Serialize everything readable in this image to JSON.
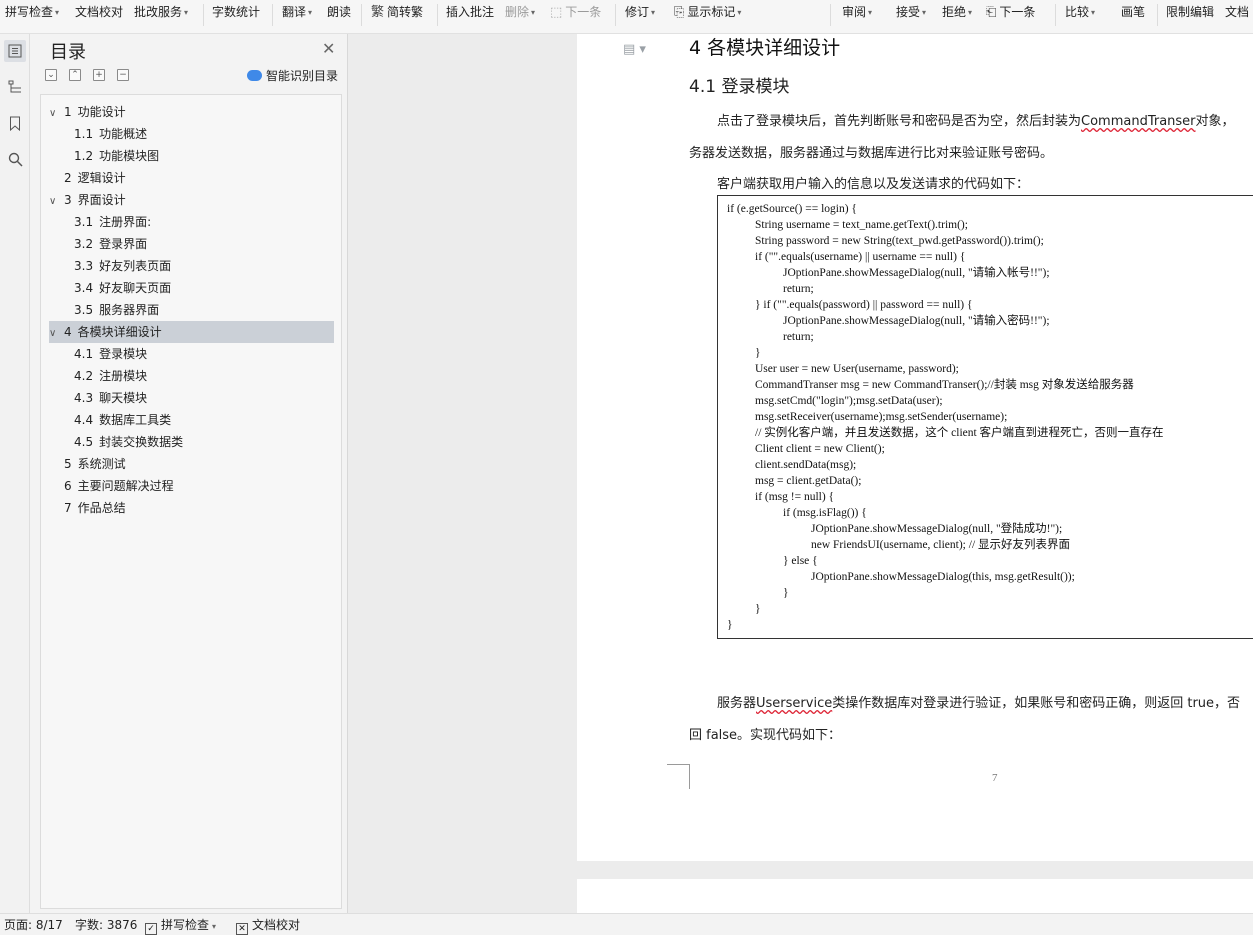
{
  "toolbar": {
    "spell_check": "拼写检查",
    "doc_proof": "文档校对",
    "revise_service": "批改服务",
    "word_count": "字数统计",
    "translate": "翻译",
    "read_aloud": "朗读",
    "simp_trad": "简转繁",
    "insert_comment": "插入批注",
    "delete": "删除",
    "next_comment": "下一条",
    "revise": "修订",
    "show_marks": "显示标记",
    "review": "审阅",
    "accept": "接受",
    "reject": "拒绝",
    "next_change": "下一条",
    "compare": "比较",
    "ink": "画笔",
    "restrict_edit": "限制编辑",
    "doc_rights": "文档"
  },
  "toc": {
    "title": "目录",
    "smart_button": "智能识别目录",
    "items": [
      {
        "num": "1",
        "text": "功能设计",
        "level": 1,
        "expanded": true
      },
      {
        "num": "1.1",
        "text": "功能概述",
        "level": 2
      },
      {
        "num": "1.2",
        "text": "功能模块图",
        "level": 2
      },
      {
        "num": "2",
        "text": "逻辑设计",
        "level": 1
      },
      {
        "num": "3",
        "text": "界面设计",
        "level": 1,
        "expanded": true
      },
      {
        "num": "3.1",
        "text": "注册界面:",
        "level": 2
      },
      {
        "num": "3.2",
        "text": "登录界面",
        "level": 2
      },
      {
        "num": "3.3",
        "text": "好友列表页面",
        "level": 2
      },
      {
        "num": "3.4",
        "text": "好友聊天页面",
        "level": 2
      },
      {
        "num": "3.5",
        "text": "服务器界面",
        "level": 2
      },
      {
        "num": "4",
        "text": "各模块详细设计",
        "level": 1,
        "expanded": true,
        "selected": true
      },
      {
        "num": "4.1",
        "text": "登录模块",
        "level": 2
      },
      {
        "num": "4.2",
        "text": "注册模块",
        "level": 2
      },
      {
        "num": "4.3",
        "text": "聊天模块",
        "level": 2
      },
      {
        "num": "4.4",
        "text": "数据库工具类",
        "level": 2
      },
      {
        "num": "4.5",
        "text": "封装交换数据类",
        "level": 2
      },
      {
        "num": "5",
        "text": "系统测试",
        "level": 1
      },
      {
        "num": "6",
        "text": "主要问题解决过程",
        "level": 1
      },
      {
        "num": "7",
        "text": "作品总结",
        "level": 1
      }
    ]
  },
  "document": {
    "heading1": "4  各模块详细设计",
    "heading2": "4.1 登录模块",
    "para1_a": "点击了登录模块后，首先判断账号和密码是否为空，然后封装为",
    "para1_b": "CommandTranser",
    "para1_c": "对象，",
    "para1_line2": "务器发送数据，服务器通过与数据库进行比对来验证账号密码。",
    "para2": "客户端获取用户输入的信息以及发送请求的代码如下：",
    "code_lines": [
      {
        "indent": 0,
        "text": "if (e.getSource() == login) {"
      },
      {
        "indent": 1,
        "text": "String username = text_name.getText().trim();"
      },
      {
        "indent": 1,
        "text": "String password = new String(text_pwd.getPassword()).trim();"
      },
      {
        "indent": 1,
        "text": "if (\"\".equals(username) || username == null) {"
      },
      {
        "indent": 2,
        "text": "JOptionPane.showMessageDialog(null, \"请输入帐号!!\");"
      },
      {
        "indent": 2,
        "text": "return;"
      },
      {
        "indent": 1,
        "text": "} if (\"\".equals(password) || password == null) {"
      },
      {
        "indent": 2,
        "text": "JOptionPane.showMessageDialog(null, \"请输入密码!!\");"
      },
      {
        "indent": 2,
        "text": "return;"
      },
      {
        "indent": 1,
        "text": "}"
      },
      {
        "indent": 1,
        "text": "User user = new User(username, password);"
      },
      {
        "indent": 1,
        "text": "CommandTranser msg = new CommandTranser();//封装 msg 对象发送给服务器"
      },
      {
        "indent": 1,
        "text": "msg.setCmd(\"login\");msg.setData(user);"
      },
      {
        "indent": 1,
        "text": "msg.setReceiver(username);msg.setSender(username);"
      },
      {
        "indent": 1,
        "text": "//  实例化客户端，并且发送数据，这个 client 客户端直到进程死亡，否则一直存在"
      },
      {
        "indent": 1,
        "text": "Client client = new Client();"
      },
      {
        "indent": 1,
        "text": "client.sendData(msg);"
      },
      {
        "indent": 1,
        "text": "msg = client.getData();"
      },
      {
        "indent": 1,
        "text": "if (msg != null) {"
      },
      {
        "indent": 2,
        "text": "if (msg.isFlag()) {"
      },
      {
        "indent": 3,
        "text": "JOptionPane.showMessageDialog(null, \"登陆成功!\");"
      },
      {
        "indent": 3,
        "text": "new FriendsUI(username, client); //  显示好友列表界面"
      },
      {
        "indent": 2,
        "text": "} else {"
      },
      {
        "indent": 3,
        "text": "JOptionPane.showMessageDialog(this, msg.getResult());"
      },
      {
        "indent": 2,
        "text": "}"
      },
      {
        "indent": 1,
        "text": "}"
      },
      {
        "indent": 0,
        "text": "}"
      }
    ],
    "para3_a": "服务器",
    "para3_b": "Userservice",
    "para3_c": "类操作数据库对登录进行验证，如果账号和密码正确，则返回 true，否",
    "para3_line2": "回 false。实现代码如下：",
    "page_number": "7"
  },
  "statusbar": {
    "page": "页面: 8/17",
    "word_count": "字数: 3876",
    "spell_check": "拼写检查",
    "doc_proof": "文档校对"
  }
}
